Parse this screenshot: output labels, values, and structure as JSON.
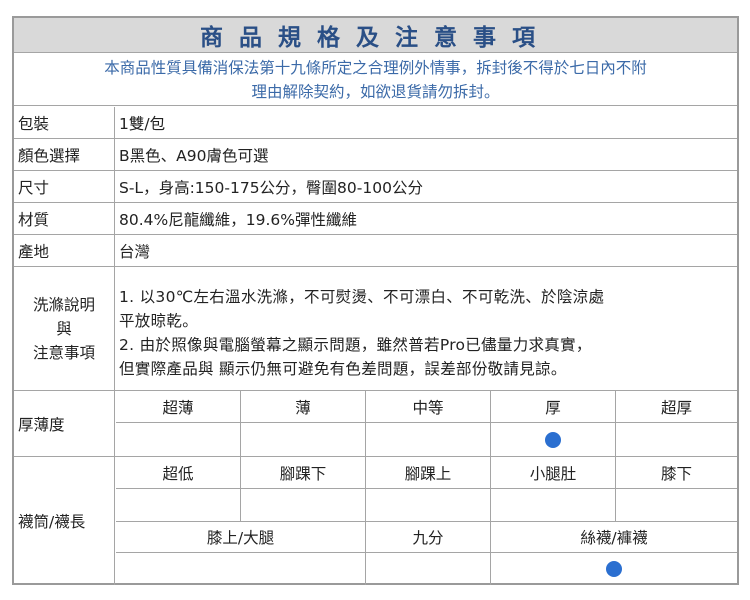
{
  "title": "商品規格及注意事項",
  "notice": {
    "line1": "本商品性質具備消保法第十九條所定之合理例外情事，拆封後不得於七日內不附",
    "line2": "理由解除契約，如欲退貨請勿拆封。"
  },
  "specs": [
    {
      "label": "包裝",
      "value": "1雙/包"
    },
    {
      "label": "顏色選擇",
      "value": "B黑色、A90膚色可選"
    },
    {
      "label": "尺寸",
      "value": "S-L，身高:150-175公分，臀圍80-100公分"
    },
    {
      "label": "材質",
      "value": "80.4%尼龍纖維，19.6%彈性纖維"
    },
    {
      "label": "產地",
      "value": "台灣"
    }
  ],
  "washing": {
    "label_line1": "洗滌說明",
    "label_line2": "與",
    "label_line3": "注意事項",
    "lines": [
      "1.  以30℃左右溫水洗滌，不可熨燙、不可漂白、不可乾洗、於陰涼處",
      "平放晾乾。",
      "2.  由於照像與電腦螢幕之顯示問題，雖然普若Pro已儘量力求真實，",
      "但實際產品與 顯示仍無可避免有色差問題，誤差部份敬請見諒。"
    ]
  },
  "thickness": {
    "label": "厚薄度",
    "options": [
      "超薄",
      "薄",
      "中等",
      "厚",
      "超厚"
    ],
    "selected_index": 3
  },
  "length": {
    "label": "襪筒/襪長",
    "options_row1": [
      "超低",
      "腳踝下",
      "腳踝上",
      "小腿肚",
      "膝下"
    ],
    "options_row2": [
      "膝上/大腿",
      "九分",
      "絲襪/褲襪"
    ],
    "selected_row2_index": 2
  },
  "colors": {
    "title_text": "#2a4f86",
    "notice_text": "#3b6aa8",
    "title_bg": "#d9d9d9",
    "marker": "#2b6fd0",
    "border": "#a5a5a5"
  }
}
